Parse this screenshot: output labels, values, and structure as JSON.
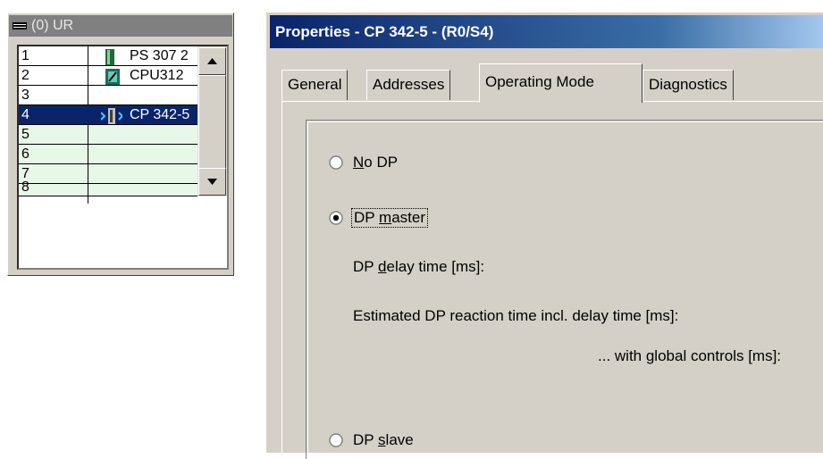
{
  "rack": {
    "title": "(0) UR",
    "rows": [
      {
        "slot": "1",
        "module": "PS 307 2",
        "icon": "power-supply-icon"
      },
      {
        "slot": "2",
        "module": "CPU312",
        "icon": "cpu-module-icon"
      },
      {
        "slot": "3",
        "module": ""
      },
      {
        "slot": "4",
        "module": "CP 342-5",
        "icon": "cp-module-icon",
        "selected": true
      },
      {
        "slot": "5",
        "module": ""
      },
      {
        "slot": "6",
        "module": ""
      },
      {
        "slot": "7",
        "module": ""
      },
      {
        "slot": "8",
        "module": ""
      }
    ]
  },
  "dialog": {
    "title": "Properties - CP 342-5 - (R0/S4)",
    "tabs": [
      "General",
      "Addresses",
      "Operating Mode",
      "Diagnostics"
    ],
    "active_tab": "Operating Mode",
    "options": {
      "no_dp": {
        "pre": "",
        "ul": "N",
        "post": "o DP"
      },
      "dp_master": {
        "pre": "DP ",
        "ul": "m",
        "post": "aster"
      },
      "dp_slave": {
        "pre": "DP ",
        "ul": "s",
        "post": "lave"
      }
    },
    "selected_option": "DP master",
    "delay_label": {
      "pre": "DP ",
      "ul": "d",
      "post": "elay time [ms]:"
    },
    "reaction_label": "Estimated DP reaction time incl. delay time [ms]:",
    "global_label": "... with global controls [ms]:"
  },
  "colors": {
    "selection": "#0a246a",
    "empty_slot": "#e8f8e8",
    "dialog_face": "#d4d0c8"
  }
}
